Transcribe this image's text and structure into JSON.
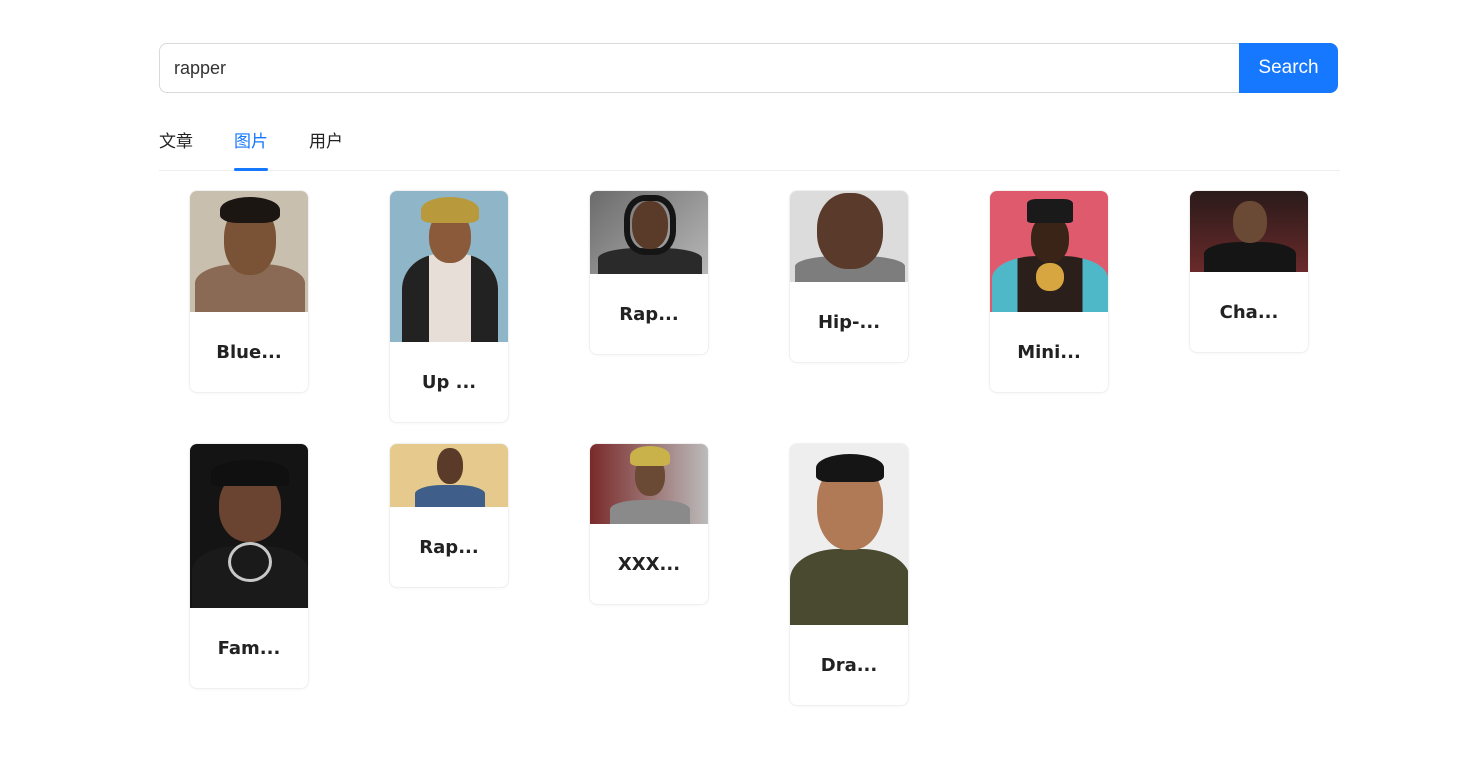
{
  "search": {
    "value": "rapper",
    "button_label": "Search"
  },
  "tabs": [
    {
      "label": "文章",
      "active": false
    },
    {
      "label": "图片",
      "active": true
    },
    {
      "label": "用户",
      "active": false
    }
  ],
  "accent_color": "#1677ff",
  "results": [
    {
      "title": "Blue..."
    },
    {
      "title": "Up ..."
    },
    {
      "title": "Rap..."
    },
    {
      "title": "Hip-..."
    },
    {
      "title": "Mini..."
    },
    {
      "title": "Cha..."
    },
    {
      "title": "Fam..."
    },
    {
      "title": "Rap..."
    },
    {
      "title": "XXX..."
    },
    {
      "title": "Dra..."
    }
  ]
}
